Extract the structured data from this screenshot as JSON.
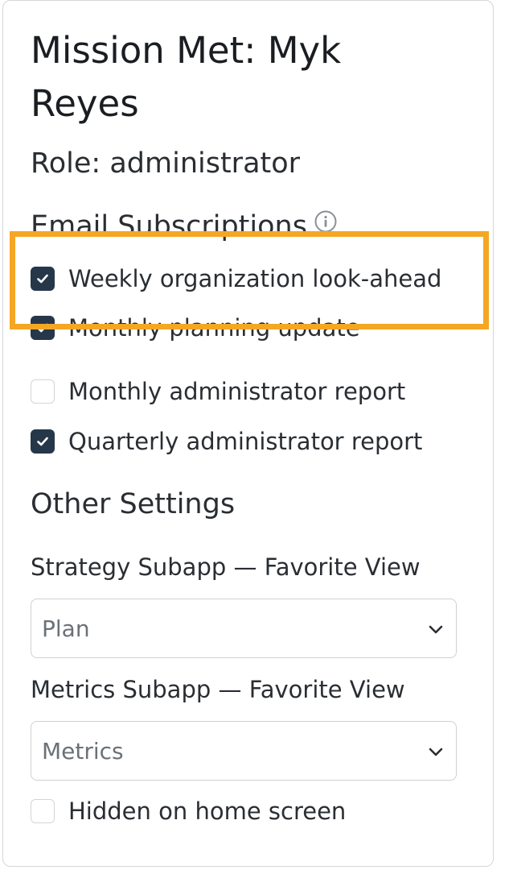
{
  "profile": {
    "title": "Mission Met: Myk Reyes",
    "role": "Role: administrator"
  },
  "subscriptions": {
    "heading": "Email Subscriptions",
    "info_icon": "info-circle-icon",
    "items": [
      {
        "label": "Weekly organization look-ahead",
        "checked": true
      },
      {
        "label": "Monthly planning update",
        "checked": true
      },
      {
        "label": "Monthly administrator report",
        "checked": false
      },
      {
        "label": "Quarterly administrator report",
        "checked": true
      }
    ]
  },
  "other_settings": {
    "heading": "Other Settings",
    "strategy_label": "Strategy Subapp — Favorite View",
    "strategy_value": "Plan",
    "metrics_label": "Metrics Subapp — Favorite View",
    "metrics_value": "Metrics",
    "hidden_label": "Hidden on home screen",
    "hidden_checked": false
  },
  "colors": {
    "checkbox_checked": "#26374a",
    "highlight": "#f5a623"
  }
}
